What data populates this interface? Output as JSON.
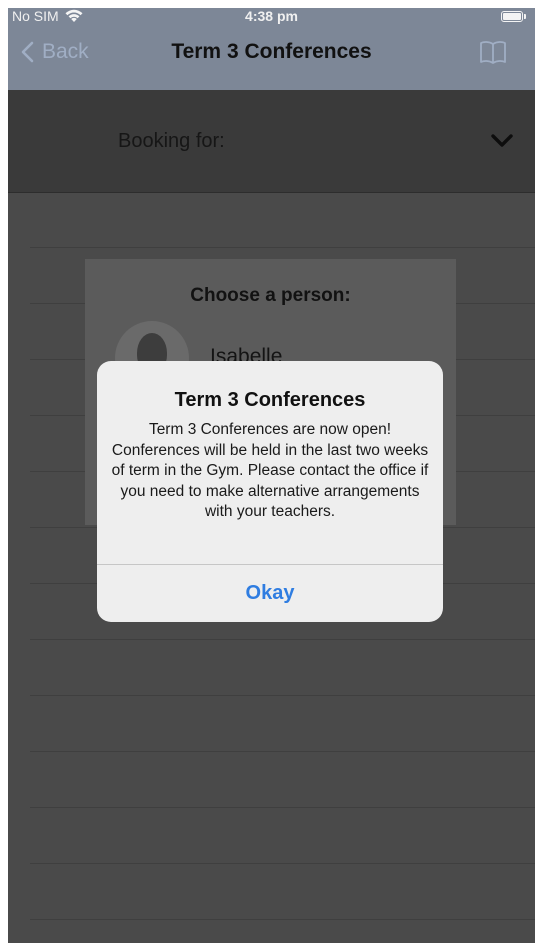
{
  "status_bar": {
    "carrier": "No SIM",
    "time": "4:38 pm"
  },
  "nav": {
    "back_label": "Back",
    "title": "Term 3 Conferences"
  },
  "booking": {
    "label": "Booking for:"
  },
  "chooser": {
    "title": "Choose a person:",
    "person_name": "Isabelle"
  },
  "alert": {
    "title": "Term 3 Conferences",
    "message": "Term 3 Conferences are now open! Conferences will be held in the last two weeks of term in the Gym. Please contact the office if you need to make alternative arrangements with your teachers.",
    "button_label": "Okay"
  },
  "colors": {
    "accent": "#2f7de1",
    "nav_bar": "#7d8797",
    "overlay_background": "#4a4a4a",
    "alert_background": "#eeeeee"
  },
  "icons": {
    "wifi": "wifi-icon",
    "battery": "battery-icon",
    "back": "chevron-left-icon",
    "book": "book-icon",
    "dropdown": "chevron-down-icon",
    "avatar": "person-avatar-icon"
  }
}
